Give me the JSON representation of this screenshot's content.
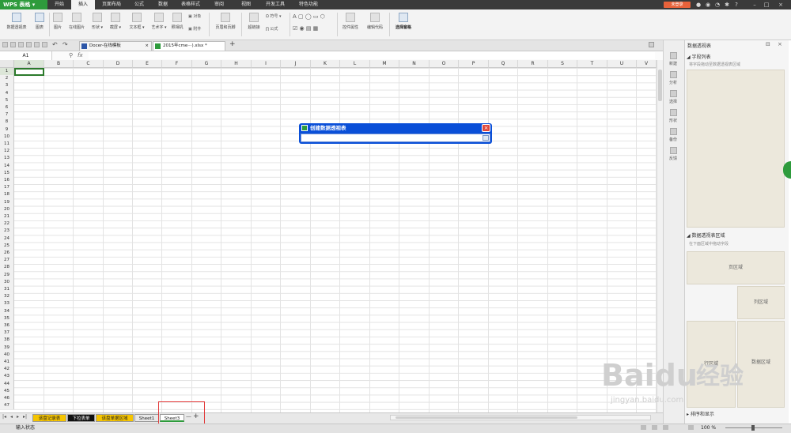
{
  "app": {
    "name": "WPS 表格"
  },
  "menu_tabs": [
    "开始",
    "插入",
    "页面布局",
    "公式",
    "数据",
    "表格样式",
    "审阅",
    "视图",
    "开发工具",
    "特色功能"
  ],
  "active_menu_tab": "插入",
  "login_label": "未登录",
  "ribbon": {
    "pivot_table": "数据透视表",
    "chart": "图表",
    "picture": "图片",
    "online_picture": "在线图片",
    "shapes": "形状",
    "screenshot": "截屏",
    "textbox": "文本框",
    "wordart": "艺术字",
    "camera": "照相机",
    "object": "对象",
    "attachment": "附件",
    "header_footer": "页眉和页脚",
    "hyperlink": "超链接",
    "symbol": "符号",
    "formula": "公式",
    "control_properties": "控件属性",
    "edit_code": "编辑代码",
    "select_pane": "选择窗格"
  },
  "doc_tabs": [
    {
      "label": "Docer-在线模板"
    },
    {
      "label": "2015年cme···).xlsx *"
    }
  ],
  "name_box": "A1",
  "fx": "fx",
  "columns": [
    "A",
    "B",
    "C",
    "D",
    "E",
    "F",
    "G",
    "H",
    "I",
    "J",
    "K",
    "L",
    "M",
    "N",
    "O",
    "P",
    "Q",
    "R",
    "S",
    "T",
    "U",
    "V"
  ],
  "rows": [
    "1",
    "2",
    "3",
    "4",
    "5",
    "6",
    "7",
    "8",
    "9",
    "10",
    "11",
    "12",
    "13",
    "14",
    "15",
    "16",
    "17",
    "18",
    "19",
    "20",
    "21",
    "22",
    "23",
    "24",
    "25",
    "26",
    "27",
    "28",
    "29",
    "30",
    "31",
    "32",
    "33",
    "34",
    "35",
    "36",
    "37",
    "38",
    "39",
    "40",
    "41",
    "42",
    "43",
    "44",
    "45",
    "46",
    "47"
  ],
  "dialog": {
    "title": "创建数据透视表"
  },
  "sheet_tabs": [
    {
      "label": "该盘记录表",
      "color": "#f5c400"
    },
    {
      "label": "下拉表单",
      "color": "#111111"
    },
    {
      "label": "该盘单据区域",
      "color": "#f5c400"
    },
    {
      "label": "Sheet1",
      "color": "#e8e8e8"
    },
    {
      "label": "Sheet3",
      "color": "#ffffff"
    }
  ],
  "status": {
    "mode": "输入状态",
    "zoom": "100 %"
  },
  "side_toolbar": [
    "新建",
    "分析",
    "选择",
    "形状",
    "备份",
    "反馈"
  ],
  "pivot_pane": {
    "title": "数据透视表",
    "field_list": "字段列表",
    "field_hint": "将字段拖动至数据透视表区域",
    "areas_title": "数据透视表区域",
    "areas_hint": "在下面区域中拖动字段",
    "page_area": "页区域",
    "col_area": "列区域",
    "row_area": "行区域",
    "data_area": "数据区域",
    "sort_display": "排序和显示"
  },
  "watermark": {
    "brand": "Baidu",
    "text": "经验",
    "url": "jingyan.baidu.com"
  }
}
